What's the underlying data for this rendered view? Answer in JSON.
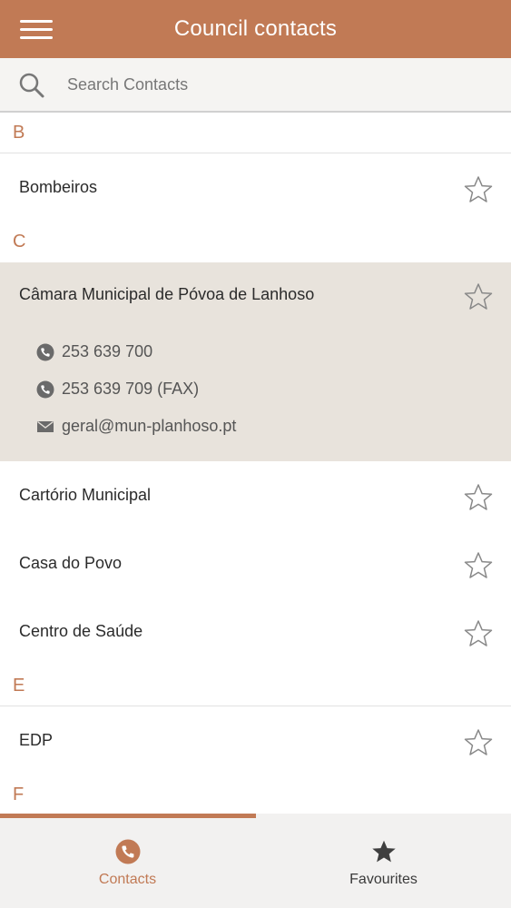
{
  "header": {
    "title": "Council contacts"
  },
  "search": {
    "placeholder": "Search Contacts",
    "value": ""
  },
  "sections": [
    {
      "letter": "B",
      "items": [
        "Bombeiros"
      ]
    },
    {
      "letter": "C",
      "items": [
        {
          "name": "Câmara Municipal de Póvoa de Lanhoso",
          "expanded": true,
          "phone": "253 639 700",
          "fax": "253 639 709 (FAX)",
          "email": "geral@mun-planhoso.pt"
        },
        "Cartório Municipal",
        "Casa do Povo",
        "Centro de Saúde"
      ]
    },
    {
      "letter": "E",
      "items": [
        "EDP"
      ]
    },
    {
      "letter": "F",
      "items": []
    }
  ],
  "tabs": {
    "contacts": "Contacts",
    "favourites": "Favourites",
    "active": "contacts"
  },
  "colors": {
    "accent": "#c17a55",
    "expanded_bg": "#e8e3dc",
    "tabbar_bg": "#f2f1f0"
  },
  "icons": {
    "menu": "hamburger-icon",
    "search": "search-icon",
    "star": "star-outline-icon",
    "phone": "phone-icon",
    "mail": "mail-icon",
    "fav": "star-filled-icon"
  }
}
